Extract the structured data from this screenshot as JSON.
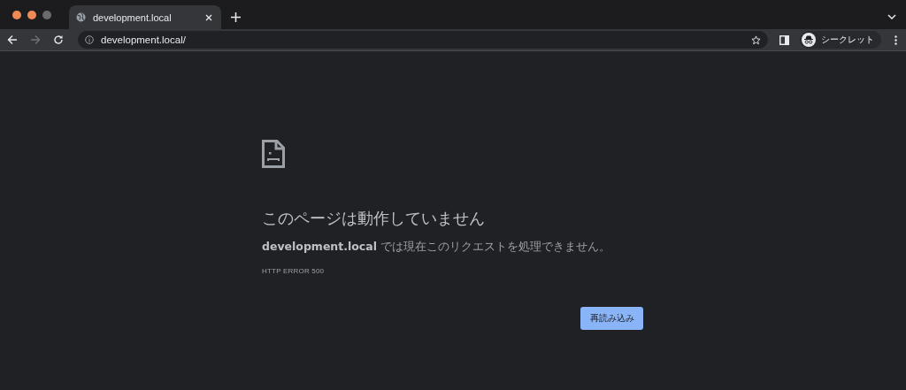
{
  "tabs": [
    {
      "title": "development.local",
      "selected": true
    }
  ],
  "address_bar": {
    "value": "development.local/"
  },
  "profile": {
    "label": "シークレット"
  },
  "error_page": {
    "heading": "このページは動作していません",
    "message": "**development.local** では現在このリクエストを処理できません。",
    "code": "HTTP ERROR 500",
    "button": "再読み込み"
  }
}
